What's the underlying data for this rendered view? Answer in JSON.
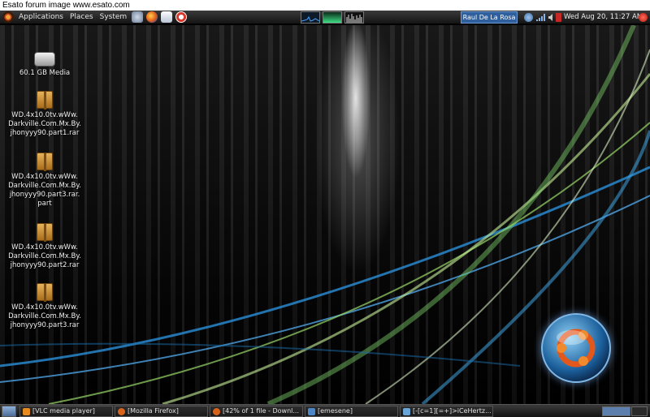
{
  "watermark": "Esato forum image www.esato.com",
  "top_panel": {
    "menus": [
      "Applications",
      "Places",
      "System"
    ],
    "user": "Raul De La Rosa",
    "clock": "Wed Aug 20, 11:27 AM"
  },
  "desktop_icons": [
    {
      "label": "60.1 GB Media"
    },
    {
      "label": "WD.4x10.0tv.wWw.\nDarkville.Com.Mx.By.\njhonyyy90.part1.rar"
    },
    {
      "label": "WD.4x10.0tv.wWw.\nDarkville.Com.Mx.By.\njhonyyy90.part3.rar.\npart"
    },
    {
      "label": "WD.4x10.0tv.wWw.\nDarkville.Com.Mx.By.\njhonyyy90.part2.rar"
    },
    {
      "label": "WD.4x10.0tv.wWw.\nDarkville.Com.Mx.By.\njhonyyy90.part3.rar"
    }
  ],
  "taskbar": {
    "tasks": [
      {
        "label": "[VLC media player]",
        "icon": "vlc-icon",
        "color": "#e68a1e"
      },
      {
        "label": "[Mozilla Firefox]",
        "icon": "firefox-icon",
        "color": "#d8641c"
      },
      {
        "label": "[42% of 1 file - Downl...",
        "icon": "download-icon",
        "color": "#d8641c"
      },
      {
        "label": "[emesene]",
        "icon": "emesene-icon",
        "color": "#4a86c8"
      },
      {
        "label": "[-[c=1][=+]>iCeHertz...",
        "icon": "chat-icon",
        "color": "#6aa5d8"
      }
    ]
  },
  "colors": {
    "panel": "#1e1e1e",
    "user_box": "#2f5f9c",
    "net_monitor": "#3ddc84"
  }
}
